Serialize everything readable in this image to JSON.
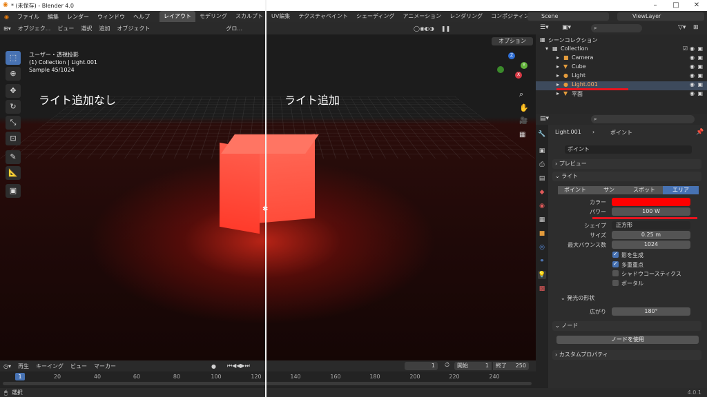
{
  "window": {
    "title": "* (未保存) - Blender 4.0",
    "minimize": "–",
    "maximize": "□",
    "close": "✕"
  },
  "menu": [
    "ファイル",
    "編集",
    "レンダー",
    "ウィンドウ",
    "ヘルプ"
  ],
  "workspaces": [
    "レイアウト",
    "モデリング",
    "スカルプト",
    "UV編集",
    "テクスチャペイント",
    "シェーディング",
    "アニメーション",
    "レンダリング",
    "コンポジティング"
  ],
  "active_workspace": "レイアウト",
  "scene": {
    "label": "Scene",
    "viewlayer": "ViewLayer"
  },
  "viewport_header": {
    "mode": "オブジェク...",
    "view": "ビュー",
    "select": "選択",
    "add": "追加",
    "object": "オブジェクト",
    "orientation": "グロ...",
    "options": "オプション"
  },
  "viewport_info": {
    "line1": "ユーザー・透視投影",
    "line2": "(1) Collection | Light.001",
    "line3": "Sample 45/1024"
  },
  "overlay_left": "ライト追加なし",
  "overlay_right": "ライト追加",
  "timeline": {
    "playback": "再生",
    "keying": "キーイング",
    "view": "ビュー",
    "marker": "マーカー",
    "current_frame": "1",
    "start_label": "開始",
    "start": "1",
    "end_label": "終了",
    "end": "250",
    "ticks": [
      "1",
      "20",
      "40",
      "60",
      "80",
      "100",
      "120",
      "140",
      "160",
      "180",
      "200",
      "220",
      "240"
    ]
  },
  "status": {
    "select": "選択",
    "version": "4.0.1"
  },
  "outliner": {
    "scene_collection": "シーンコレクション",
    "collection": "Collection",
    "items": [
      "Camera",
      "Cube",
      "Light",
      "Light.001",
      "平面"
    ]
  },
  "properties": {
    "object": "Light.001",
    "data": "ポイント",
    "datablock": "ポイント",
    "preview": "プレビュー",
    "light": "ライト",
    "types": [
      "ポイント",
      "サン",
      "スポット",
      "エリア"
    ],
    "active_type": "エリア",
    "color_label": "カラー",
    "color": "#ff0000",
    "power_label": "パワー",
    "power": "100 W",
    "shape_label": "シェイプ",
    "shape": "正方形",
    "size_label": "サイズ",
    "size": "0.25 m",
    "bounces_label": "最大バウンス数",
    "bounces": "1024",
    "cast_shadow": "影を生成",
    "multiple_importance": "多重重点",
    "shadow_caustics": "シャドウコースティクス",
    "portal": "ポータル",
    "beam_shape": "発光の形状",
    "spread_label": "広がり",
    "spread": "180°",
    "nodes": "ノード",
    "use_nodes": "ノードを使用",
    "custom_props": "カスタムプロパティ"
  }
}
